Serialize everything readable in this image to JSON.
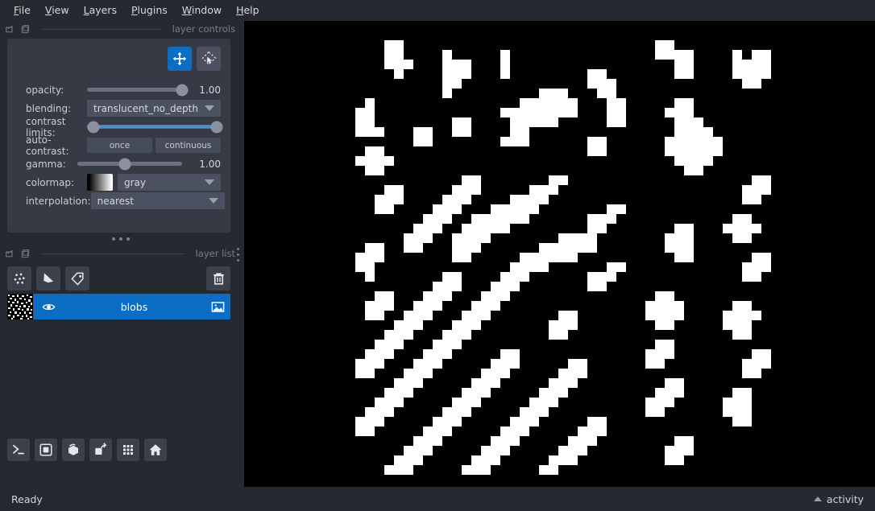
{
  "app": {
    "title": "napari",
    "background": "#262930",
    "panel": "#363a45",
    "accent": "#0b6ec4",
    "canvas_background": "#000000"
  },
  "menubar": {
    "items": [
      {
        "label": "File",
        "mnemonic": "F"
      },
      {
        "label": "View",
        "mnemonic": "V"
      },
      {
        "label": "Layers",
        "mnemonic": "L"
      },
      {
        "label": "Plugins",
        "mnemonic": "P"
      },
      {
        "label": "Window",
        "mnemonic": "W"
      },
      {
        "label": "Help",
        "mnemonic": "H"
      }
    ]
  },
  "layer_controls": {
    "dock_title": "layer controls",
    "float_icon": "float-dock-icon",
    "close_icon": "close-dock-icon",
    "mode_buttons": [
      {
        "name": "pan-zoom",
        "icon": "pan-zoom-icon",
        "active": true
      },
      {
        "name": "transform",
        "icon": "transform-icon",
        "active": false
      }
    ],
    "opacity": {
      "label": "opacity:",
      "value": "1.00",
      "percent": 100
    },
    "blending": {
      "label": "blending:",
      "value": "translucent_no_depth"
    },
    "contrast_limits": {
      "label": "contrast limits:",
      "low_percent": 0,
      "high_percent": 100
    },
    "auto_contrast": {
      "label": "auto-contrast:",
      "once": "once",
      "continuous": "continuous"
    },
    "gamma": {
      "label": "gamma:",
      "value": "1.00",
      "percent": 35
    },
    "colormap": {
      "label": "colormap:",
      "value": "gray",
      "swatch": "black-to-white-gradient"
    },
    "interpolation": {
      "label": "interpolation:",
      "value": "nearest"
    }
  },
  "layer_list": {
    "dock_title": "layer list",
    "float_icon": "float-dock-icon",
    "close_icon": "close-dock-icon",
    "tools": [
      {
        "name": "new-points-layer",
        "icon": "points-icon"
      },
      {
        "name": "new-shapes-layer",
        "icon": "shapes-icon"
      },
      {
        "name": "new-labels-layer",
        "icon": "labels-icon"
      }
    ],
    "delete_button": {
      "name": "delete-layer",
      "icon": "trash-icon"
    },
    "layers": [
      {
        "name": "blobs",
        "visible": true,
        "selected": true,
        "type_icon": "image-layer-icon",
        "visibility_icon": "eye-icon",
        "thumbnail": "blobs-thumbnail"
      }
    ]
  },
  "viewer_buttons": [
    {
      "name": "console",
      "icon": "console-icon"
    },
    {
      "name": "ndisplay-2d",
      "icon": "square-icon"
    },
    {
      "name": "roll-dims",
      "icon": "cube-icon"
    },
    {
      "name": "transpose-dims",
      "icon": "transpose-icon"
    },
    {
      "name": "grid-view",
      "icon": "grid-icon"
    },
    {
      "name": "reset-view",
      "icon": "home-icon"
    }
  ],
  "statusbar": {
    "status": "Ready",
    "activity_label": "activity",
    "activity_icon": "chevron-up-icon"
  },
  "canvas": {
    "layer": "blobs",
    "pixel_size": 12,
    "grid_cols": 46,
    "grid_rows": 48,
    "colors": {
      "on": "#ffffff",
      "off": "#000000"
    },
    "rows": [
      "0000000000000000000000000000000000000000000000",
      "0000000000000000000000000000000000000000000000",
      "0000011000000000000000000000000001100000000000",
      "0000011000010000010000000000000001111000010110",
      "0000011100011100010000000000000000011000011110",
      "0000001000011100010000000011000000011000011110",
      "0000000000011000000000000011100000000000001100",
      "0000000000010000000001110001100000000000000000",
      "0001000000000000000111111000110000011000000000",
      "0011000000000000011111111000110000111000000000",
      "0011000000001100001111100000110000011100000000",
      "0011100011001100001100000000000000011110000000",
      "0000000011000000011100000011000000111111000000",
      "0001100000000000000000000011000000111111000000",
      "0011110000000000000000000000000000011110000000",
      "0001100000000000000000000000000000001100000000",
      "0000000000000110000000110000000000000000000110",
      "0000011000001110000011100000000000000000001110",
      "0000111000011100001111000000000000000000001100",
      "0000110000111000111110000000110000000000000000",
      "0000000001110011111100000011100000000000011000",
      "0000000011100111110000000011000000011000111100",
      "0000000111001111000000011110000000111000011000",
      "0001100110001110000001111110000000111000000000",
      "0011100000001100000111111000000000011000000110",
      "0011000000000000001111000000110000000000001110",
      "0001000000011000011100000011100000000000001100",
      "0000000000111000111000000011000000000000000000",
      "0000110001110001110000000000000001100000000000",
      "0001110011100011100000000000000011110000011000",
      "0001100111000111000000011000000011110000111100",
      "0000001110001110000000111000000001100000111000",
      "0000011100011100000000110000000000000000011000",
      "0000111000111000000000000000000001100000000000",
      "0001110001110000011000000000000011100000000110",
      "0011100011100000111000001100000011000000001110",
      "0011000111000001110000011100000000000000001100",
      "0000001110000011100000111000000000110000000000",
      "0000011100000111000001110000000001110000011000",
      "0000111000001110000011100000000011100000111000",
      "0001110000011100000111000000000011000000111000",
      "0011100000111000001110000011000000000000011000",
      "0011000001110000011100000111000000000000000000",
      "0000000011100000111000001110000000011000000000",
      "0000000111000001110000011100000000111000000000",
      "0000001110000011100000111000000000110000000000",
      "0000011100000111000001100000000000000000000000",
      "0000000000000000000000000000000000000000000000"
    ]
  }
}
